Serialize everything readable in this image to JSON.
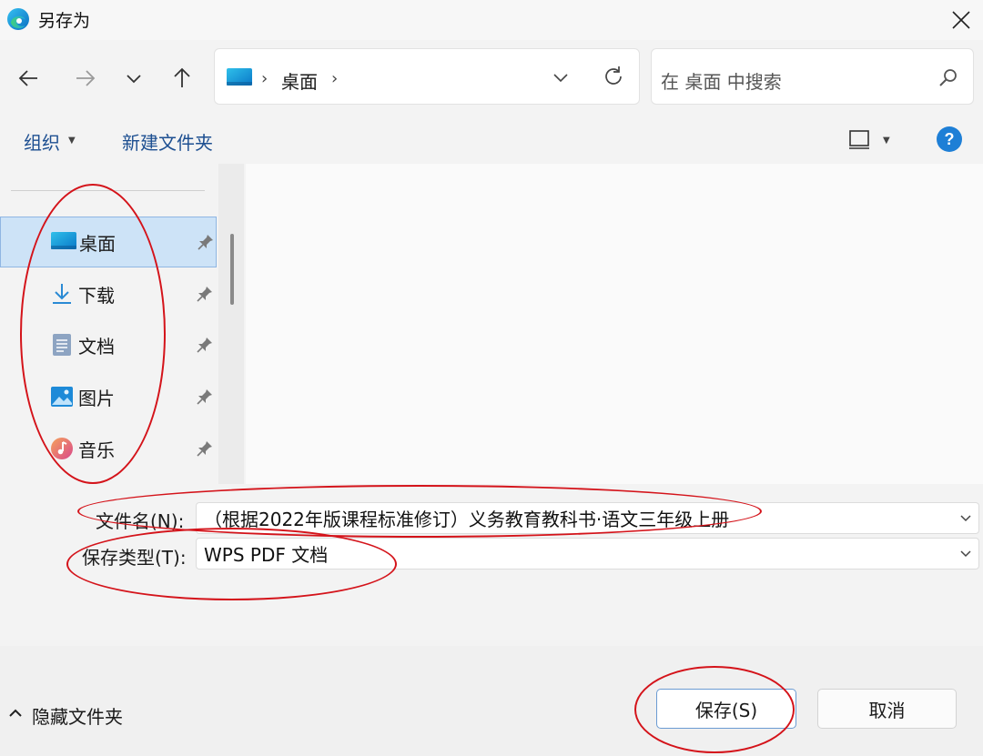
{
  "window": {
    "title": "另存为"
  },
  "address": {
    "location": "桌面"
  },
  "search": {
    "placeholder": "在 桌面 中搜索"
  },
  "toolbar": {
    "organize": "组织",
    "new_folder": "新建文件夹"
  },
  "sidebar": {
    "items": [
      {
        "label": "桌面",
        "icon": "desktop-icon",
        "selected": true
      },
      {
        "label": "下载",
        "icon": "download-icon"
      },
      {
        "label": "文档",
        "icon": "document-icon"
      },
      {
        "label": "图片",
        "icon": "pictures-icon"
      },
      {
        "label": "音乐",
        "icon": "music-icon"
      }
    ]
  },
  "form": {
    "filename_label": "文件名(N):",
    "filename_value": "（根据2022年版课程标准修订）义务教育教科书·语文三年级上册",
    "type_label": "保存类型(T):",
    "type_value": "WPS PDF 文档"
  },
  "footer": {
    "hide_folders": "隐藏文件夹",
    "save": "保存(S)",
    "cancel": "取消"
  },
  "colors": {
    "accent": "#0067c0",
    "annotation": "#d4131a"
  }
}
